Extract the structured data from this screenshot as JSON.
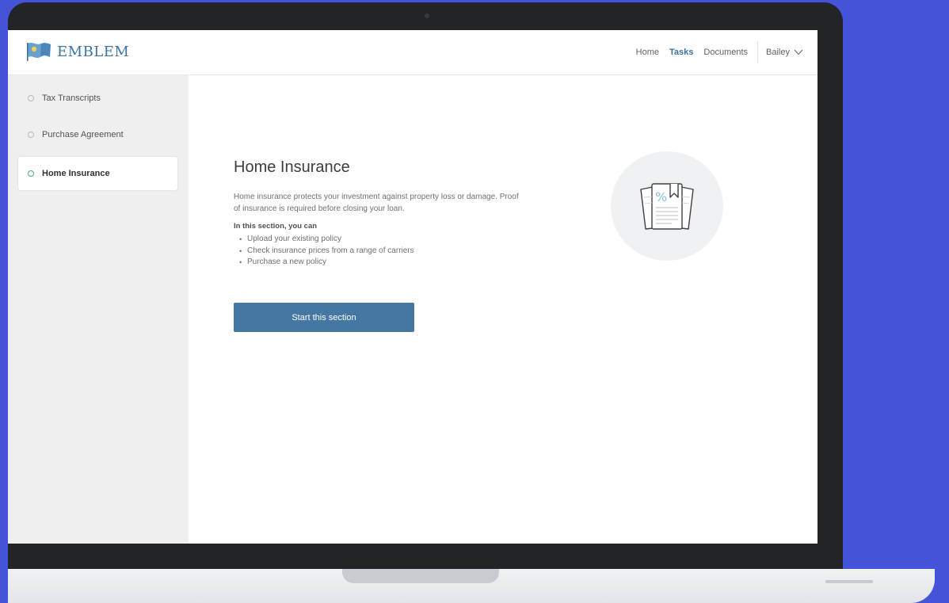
{
  "brand": {
    "name": "EMBLEM",
    "color": "#3b73a2"
  },
  "nav": {
    "links": [
      {
        "label": "Home",
        "active": false
      },
      {
        "label": "Tasks",
        "active": true
      },
      {
        "label": "Documents",
        "active": false
      }
    ],
    "user": "Bailey"
  },
  "sidebar": {
    "items": [
      {
        "label": "Tax Transcripts",
        "active": false
      },
      {
        "label": "Purchase Agreement",
        "active": false
      },
      {
        "label": "Home Insurance",
        "active": true
      }
    ]
  },
  "main": {
    "title": "Home Insurance",
    "description": "Home insurance protects your investment against property loss or damage. Proof of insurance is required before closing your loan.",
    "section_label": "In this section, you can",
    "bullets": [
      "Upload your existing policy",
      "Check insurance prices from a range of carriers",
      "Purchase a new policy"
    ],
    "button_label": "Start this section",
    "illustration_icon": "insurance-document-icon"
  },
  "colors": {
    "primary": "#4577a3",
    "active_dot": "#4ea97b",
    "background": "#4553d9"
  }
}
